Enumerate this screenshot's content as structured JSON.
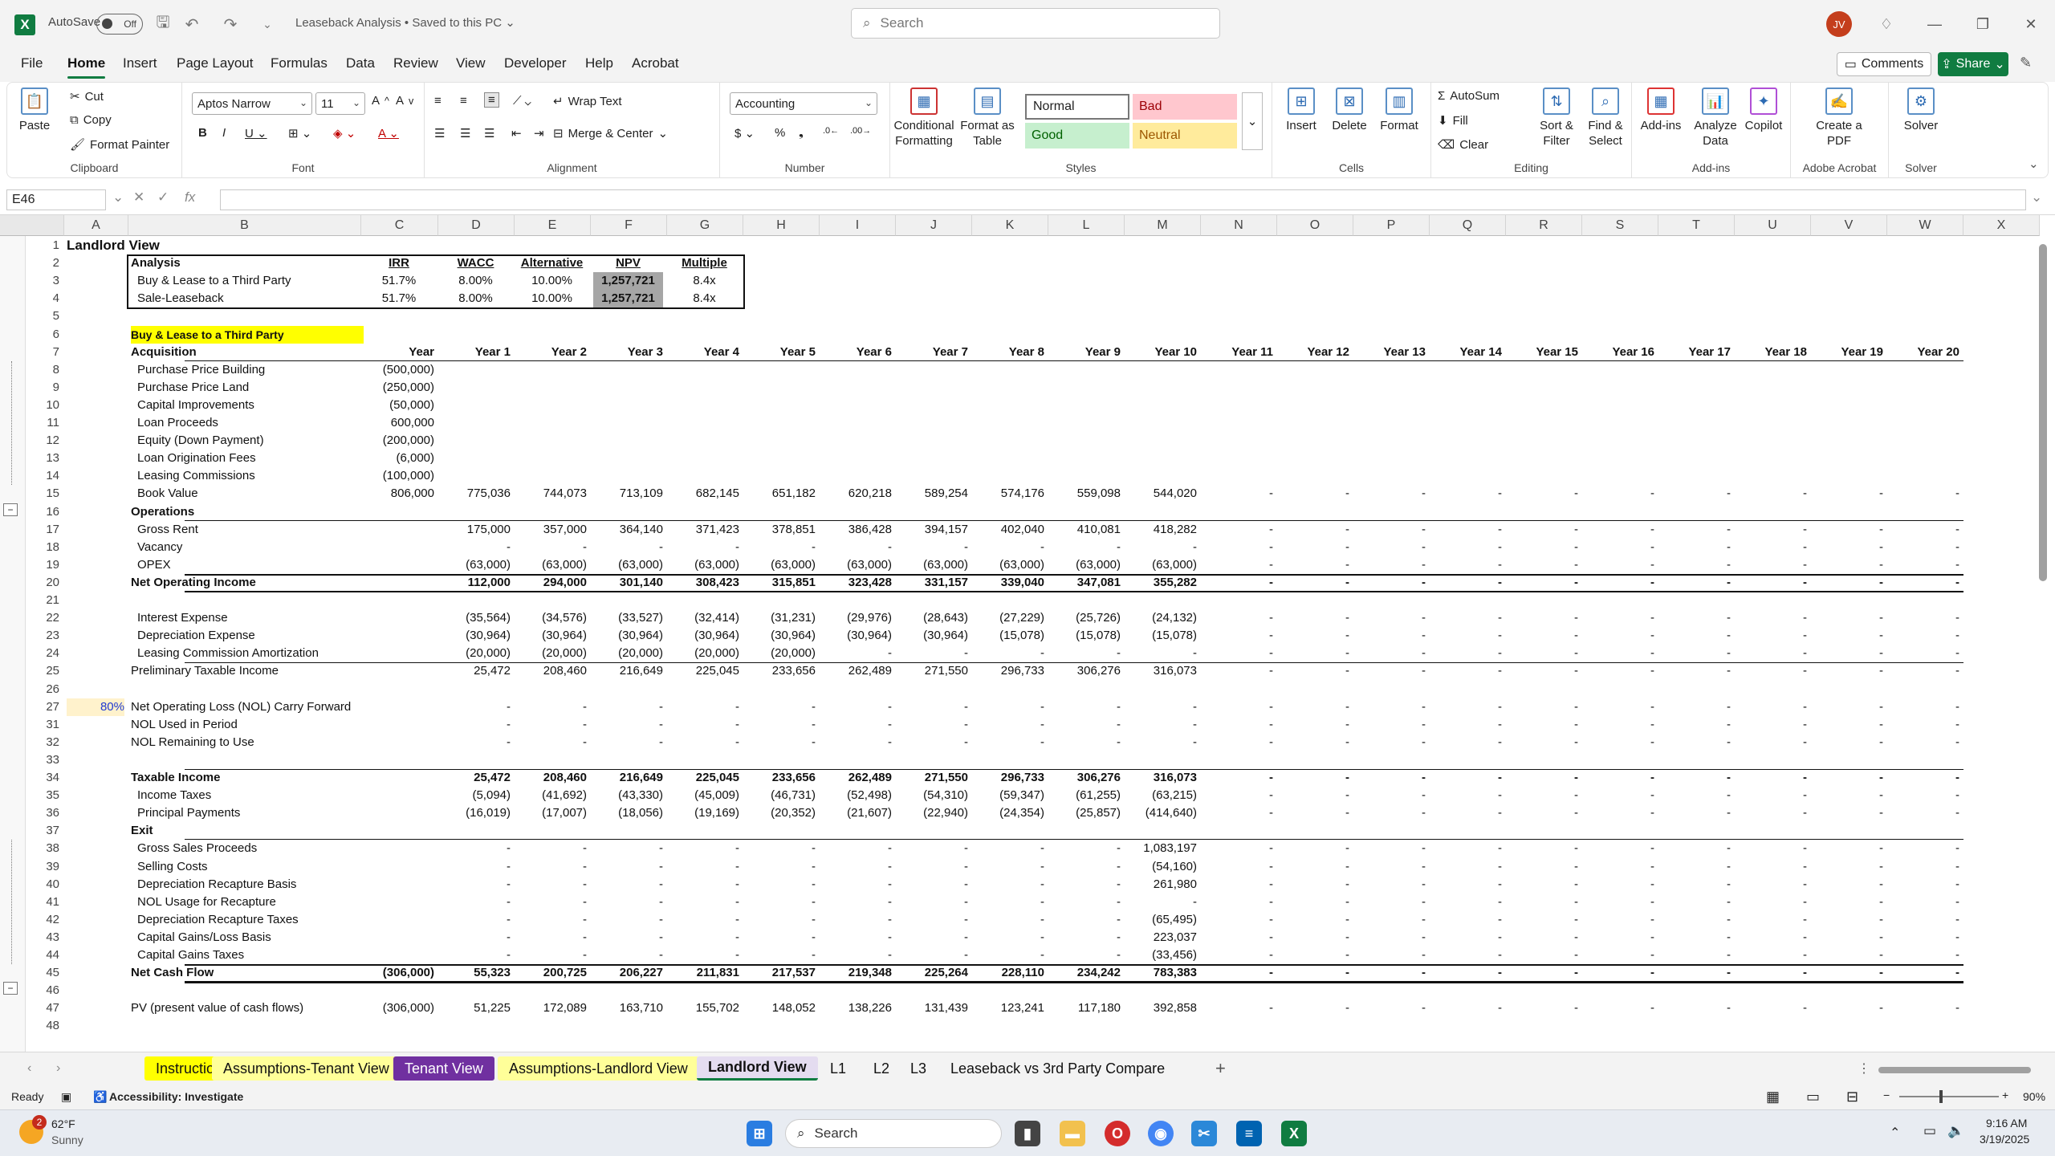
{
  "app": {
    "logo": "X",
    "autosave": "AutoSave",
    "autosave_state": "Off",
    "doc_title": "Leaseback Analysis • Saved to this PC ⌄",
    "search_placeholder": "Search",
    "avatar": "JV",
    "brand_color": "#107c41"
  },
  "menu": [
    "File",
    "Home",
    "Insert",
    "Page Layout",
    "Formulas",
    "Data",
    "Review",
    "View",
    "Developer",
    "Help",
    "Acrobat"
  ],
  "buttons": {
    "comments": "Comments",
    "share": "Share"
  },
  "ribbon": {
    "clipboard": {
      "label": "Clipboard",
      "paste": "Paste",
      "cut": "Cut",
      "copy": "Copy",
      "format_painter": "Format Painter"
    },
    "font": {
      "label": "Font",
      "name": "Aptos Narrow",
      "size": "11"
    },
    "alignment": {
      "label": "Alignment",
      "wrap": "Wrap Text",
      "merge": "Merge & Center"
    },
    "number": {
      "label": "Number",
      "format": "Accounting"
    },
    "styles": {
      "label": "Styles",
      "cond": "Conditional Formatting",
      "table": "Format as Table",
      "normal": "Normal",
      "bad": "Bad",
      "good": "Good",
      "neutral": "Neutral"
    },
    "cells": {
      "label": "Cells",
      "insert": "Insert",
      "delete": "Delete",
      "format": "Format"
    },
    "editing": {
      "label": "Editing",
      "autosum": "AutoSum",
      "fill": "Fill",
      "clear": "Clear",
      "sort": "Sort & Filter",
      "find": "Find & Select"
    },
    "addins": {
      "label": "Add-ins",
      "addins": "Add-ins",
      "analyze": "Analyze Data",
      "copilot": "Copilot"
    },
    "acrobat": {
      "label": "Adobe Acrobat",
      "create": "Create a PDF"
    },
    "solver": {
      "label": "Solver",
      "solver": "Solver"
    }
  },
  "formula": {
    "namebox": "E46",
    "fx": "fx"
  },
  "columns": [
    "A",
    "B",
    "C",
    "D",
    "E",
    "F",
    "G",
    "H",
    "I",
    "J",
    "K",
    "L",
    "M",
    "N",
    "O",
    "P",
    "Q",
    "R",
    "S",
    "T",
    "U",
    "V",
    "W",
    "X"
  ],
  "rows": [
    "1",
    "2",
    "3",
    "4",
    "5",
    "6",
    "7",
    "8",
    "9",
    "10",
    "11",
    "12",
    "13",
    "14",
    "15",
    "16",
    "17",
    "18",
    "19",
    "20",
    "21",
    "22",
    "23",
    "24",
    "25",
    "26",
    "27",
    "31",
    "32",
    "33",
    "34",
    "35",
    "36",
    "37",
    "38",
    "39",
    "40",
    "41",
    "42",
    "43",
    "44",
    "45",
    "46",
    "47",
    "48"
  ],
  "sheet": {
    "title": "Landlord View",
    "summary_headers": [
      "Analysis",
      "IRR",
      "WACC",
      "Alternative",
      "NPV",
      "Multiple"
    ],
    "summary_rows": [
      [
        "Buy & Lease to a Third Party",
        "51.7%",
        "8.00%",
        "10.00%",
        "1,257,721",
        "8.4x"
      ],
      [
        "Sale-Leaseback",
        "51.7%",
        "8.00%",
        "10.00%",
        "1,257,721",
        "8.4x"
      ]
    ],
    "section_title": "Buy & Lease to a Third Party",
    "year_headers": [
      "Year",
      "Year 1",
      "Year 2",
      "Year 3",
      "Year 4",
      "Year 5",
      "Year 6",
      "Year 7",
      "Year 8",
      "Year 9",
      "Year 10",
      "Year 11",
      "Year 12",
      "Year 13",
      "Year 14",
      "Year 15",
      "Year 16",
      "Year 17",
      "Year 18",
      "Year 19",
      "Year 20"
    ],
    "acquisition_label": "Acquisition",
    "nol_rate": "80%",
    "lines": [
      {
        "row": 8,
        "label": "Purchase Price Building",
        "indent": true,
        "vals": [
          "(500,000)"
        ]
      },
      {
        "row": 9,
        "label": "Purchase Price Land",
        "indent": true,
        "vals": [
          "(250,000)"
        ]
      },
      {
        "row": 10,
        "label": "Capital Improvements",
        "indent": true,
        "vals": [
          "(50,000)"
        ]
      },
      {
        "row": 11,
        "label": "Loan Proceeds",
        "indent": true,
        "vals": [
          "600,000"
        ]
      },
      {
        "row": 12,
        "label": "Equity (Down Payment)",
        "indent": true,
        "vals": [
          "(200,000)"
        ]
      },
      {
        "row": 13,
        "label": "Loan Origination Fees",
        "indent": true,
        "vals": [
          "(6,000)"
        ]
      },
      {
        "row": 14,
        "label": "Leasing Commissions",
        "indent": true,
        "vals": [
          "(100,000)"
        ]
      },
      {
        "row": 15,
        "label": "Book Value",
        "indent": true,
        "vals": [
          "806,000",
          "775,036",
          "744,073",
          "713,109",
          "682,145",
          "651,182",
          "620,218",
          "589,254",
          "574,176",
          "559,098",
          "544,020",
          "-",
          "-",
          "-",
          "-",
          "-",
          "-",
          "-",
          "-",
          "-",
          "-"
        ]
      },
      {
        "row": 16,
        "label": "Operations",
        "bold": true,
        "vals": []
      },
      {
        "row": 17,
        "label": "Gross Rent",
        "indent": true,
        "vals": [
          "",
          "175,000",
          "357,000",
          "364,140",
          "371,423",
          "378,851",
          "386,428",
          "394,157",
          "402,040",
          "410,081",
          "418,282",
          "-",
          "-",
          "-",
          "-",
          "-",
          "-",
          "-",
          "-",
          "-",
          "-"
        ]
      },
      {
        "row": 18,
        "label": "Vacancy",
        "indent": true,
        "vals": [
          "",
          "-",
          "-",
          "-",
          "-",
          "-",
          "-",
          "-",
          "-",
          "-",
          "-",
          "-",
          "-",
          "-",
          "-",
          "-",
          "-",
          "-",
          "-",
          "-",
          "-"
        ]
      },
      {
        "row": 19,
        "label": "OPEX",
        "indent": true,
        "vals": [
          "",
          "(63,000)",
          "(63,000)",
          "(63,000)",
          "(63,000)",
          "(63,000)",
          "(63,000)",
          "(63,000)",
          "(63,000)",
          "(63,000)",
          "(63,000)",
          "-",
          "-",
          "-",
          "-",
          "-",
          "-",
          "-",
          "-",
          "-",
          "-"
        ]
      },
      {
        "row": 20,
        "label": "Net Operating Income",
        "bold": true,
        "vals": [
          "",
          "112,000",
          "294,000",
          "301,140",
          "308,423",
          "315,851",
          "323,428",
          "331,157",
          "339,040",
          "347,081",
          "355,282",
          "-",
          "-",
          "-",
          "-",
          "-",
          "-",
          "-",
          "-",
          "-",
          "-"
        ]
      },
      {
        "row": 22,
        "label": "Interest Expense",
        "indent": true,
        "vals": [
          "",
          "(35,564)",
          "(34,576)",
          "(33,527)",
          "(32,414)",
          "(31,231)",
          "(29,976)",
          "(28,643)",
          "(27,229)",
          "(25,726)",
          "(24,132)",
          "-",
          "-",
          "-",
          "-",
          "-",
          "-",
          "-",
          "-",
          "-",
          "-"
        ]
      },
      {
        "row": 23,
        "label": "Depreciation Expense",
        "indent": true,
        "vals": [
          "",
          "(30,964)",
          "(30,964)",
          "(30,964)",
          "(30,964)",
          "(30,964)",
          "(30,964)",
          "(30,964)",
          "(15,078)",
          "(15,078)",
          "(15,078)",
          "-",
          "-",
          "-",
          "-",
          "-",
          "-",
          "-",
          "-",
          "-",
          "-"
        ]
      },
      {
        "row": 24,
        "label": "Leasing Commission Amortization",
        "indent": true,
        "vals": [
          "",
          "(20,000)",
          "(20,000)",
          "(20,000)",
          "(20,000)",
          "(20,000)",
          "-",
          "-",
          "-",
          "-",
          "-",
          "-",
          "-",
          "-",
          "-",
          "-",
          "-",
          "-",
          "-",
          "-",
          "-"
        ]
      },
      {
        "row": 25,
        "label": "Preliminary Taxable Income",
        "vals": [
          "",
          "25,472",
          "208,460",
          "216,649",
          "225,045",
          "233,656",
          "262,489",
          "271,550",
          "296,733",
          "306,276",
          "316,073",
          "-",
          "-",
          "-",
          "-",
          "-",
          "-",
          "-",
          "-",
          "-",
          "-"
        ]
      },
      {
        "row": 27,
        "label": "Net Operating Loss (NOL) Carry Forward",
        "vals": [
          "",
          "-",
          "-",
          "-",
          "-",
          "-",
          "-",
          "-",
          "-",
          "-",
          "-",
          "-",
          "-",
          "-",
          "-",
          "-",
          "-",
          "-",
          "-",
          "-",
          "-"
        ]
      },
      {
        "row": 31,
        "label": "NOL Used in Period",
        "vals": [
          "",
          "-",
          "-",
          "-",
          "-",
          "-",
          "-",
          "-",
          "-",
          "-",
          "-",
          "-",
          "-",
          "-",
          "-",
          "-",
          "-",
          "-",
          "-",
          "-",
          "-"
        ]
      },
      {
        "row": 32,
        "label": "NOL Remaining to Use",
        "vals": [
          "",
          "-",
          "-",
          "-",
          "-",
          "-",
          "-",
          "-",
          "-",
          "-",
          "-",
          "-",
          "-",
          "-",
          "-",
          "-",
          "-",
          "-",
          "-",
          "-",
          "-"
        ]
      },
      {
        "row": 34,
        "label": "Taxable Income",
        "bold": true,
        "vals": [
          "",
          "25,472",
          "208,460",
          "216,649",
          "225,045",
          "233,656",
          "262,489",
          "271,550",
          "296,733",
          "306,276",
          "316,073",
          "-",
          "-",
          "-",
          "-",
          "-",
          "-",
          "-",
          "-",
          "-",
          "-"
        ]
      },
      {
        "row": 35,
        "label": "Income Taxes",
        "indent": true,
        "vals": [
          "",
          "(5,094)",
          "(41,692)",
          "(43,330)",
          "(45,009)",
          "(46,731)",
          "(52,498)",
          "(54,310)",
          "(59,347)",
          "(61,255)",
          "(63,215)",
          "-",
          "-",
          "-",
          "-",
          "-",
          "-",
          "-",
          "-",
          "-",
          "-"
        ]
      },
      {
        "row": 36,
        "label": "Principal Payments",
        "indent": true,
        "vals": [
          "",
          "(16,019)",
          "(17,007)",
          "(18,056)",
          "(19,169)",
          "(20,352)",
          "(21,607)",
          "(22,940)",
          "(24,354)",
          "(25,857)",
          "(414,640)",
          "-",
          "-",
          "-",
          "-",
          "-",
          "-",
          "-",
          "-",
          "-",
          "-"
        ]
      },
      {
        "row": 37,
        "label": "Exit",
        "bold": true,
        "vals": []
      },
      {
        "row": 38,
        "label": "Gross Sales Proceeds",
        "indent": true,
        "vals": [
          "",
          "-",
          "-",
          "-",
          "-",
          "-",
          "-",
          "-",
          "-",
          "-",
          "1,083,197",
          "-",
          "-",
          "-",
          "-",
          "-",
          "-",
          "-",
          "-",
          "-",
          "-"
        ]
      },
      {
        "row": 39,
        "label": "Selling Costs",
        "indent": true,
        "vals": [
          "",
          "-",
          "-",
          "-",
          "-",
          "-",
          "-",
          "-",
          "-",
          "-",
          "(54,160)",
          "-",
          "-",
          "-",
          "-",
          "-",
          "-",
          "-",
          "-",
          "-",
          "-"
        ]
      },
      {
        "row": 40,
        "label": "Depreciation Recapture Basis",
        "indent": true,
        "vals": [
          "",
          "-",
          "-",
          "-",
          "-",
          "-",
          "-",
          "-",
          "-",
          "-",
          "261,980",
          "-",
          "-",
          "-",
          "-",
          "-",
          "-",
          "-",
          "-",
          "-",
          "-"
        ]
      },
      {
        "row": 41,
        "label": "NOL Usage for Recapture",
        "indent": true,
        "vals": [
          "",
          "-",
          "-",
          "-",
          "-",
          "-",
          "-",
          "-",
          "-",
          "-",
          "-",
          "-",
          "-",
          "-",
          "-",
          "-",
          "-",
          "-",
          "-",
          "-",
          "-"
        ]
      },
      {
        "row": 42,
        "label": "Depreciation Recapture Taxes",
        "indent": true,
        "vals": [
          "",
          "-",
          "-",
          "-",
          "-",
          "-",
          "-",
          "-",
          "-",
          "-",
          "(65,495)",
          "-",
          "-",
          "-",
          "-",
          "-",
          "-",
          "-",
          "-",
          "-",
          "-"
        ]
      },
      {
        "row": 43,
        "label": "Capital Gains/Loss Basis",
        "indent": true,
        "vals": [
          "",
          "-",
          "-",
          "-",
          "-",
          "-",
          "-",
          "-",
          "-",
          "-",
          "223,037",
          "-",
          "-",
          "-",
          "-",
          "-",
          "-",
          "-",
          "-",
          "-",
          "-"
        ]
      },
      {
        "row": 44,
        "label": "Capital Gains Taxes",
        "indent": true,
        "vals": [
          "",
          "-",
          "-",
          "-",
          "-",
          "-",
          "-",
          "-",
          "-",
          "-",
          "(33,456)",
          "-",
          "-",
          "-",
          "-",
          "-",
          "-",
          "-",
          "-",
          "-",
          "-"
        ]
      },
      {
        "row": 45,
        "label": "Net Cash Flow",
        "bold": true,
        "vals": [
          "(306,000)",
          "55,323",
          "200,725",
          "206,227",
          "211,831",
          "217,537",
          "219,348",
          "225,264",
          "228,110",
          "234,242",
          "783,383",
          "-",
          "-",
          "-",
          "-",
          "-",
          "-",
          "-",
          "-",
          "-",
          "-"
        ]
      },
      {
        "row": 47,
        "label": "PV (present value of cash flows)",
        "vals": [
          "(306,000)",
          "51,225",
          "172,089",
          "163,710",
          "155,702",
          "148,052",
          "138,226",
          "131,439",
          "123,241",
          "117,180",
          "392,858",
          "-",
          "-",
          "-",
          "-",
          "-",
          "-",
          "-",
          "-",
          "-",
          "-"
        ]
      }
    ]
  },
  "tabs": [
    {
      "label": "Instructions",
      "bg": "#ffff00",
      "fg": "#111"
    },
    {
      "label": "Assumptions-Tenant View",
      "bg": "#ffff99",
      "fg": "#111"
    },
    {
      "label": "Tenant View",
      "bg": "#7030a0",
      "fg": "#ffffff"
    },
    {
      "label": "Assumptions-Landlord View",
      "bg": "#ffff99",
      "fg": "#111"
    },
    {
      "label": "Landlord View",
      "bg": "#e4dcf0",
      "fg": "#111",
      "active": true
    },
    {
      "label": "L1",
      "bg": "",
      "fg": "#111"
    },
    {
      "label": "L2",
      "bg": "",
      "fg": "#111"
    },
    {
      "label": "L3",
      "bg": "",
      "fg": "#111"
    },
    {
      "label": "Leaseback vs 3rd Party Compare",
      "bg": "",
      "fg": "#111"
    }
  ],
  "status": {
    "ready": "Ready",
    "accessibility": "Accessibility: Investigate",
    "zoom": "90%"
  },
  "taskbar": {
    "temp": "62°F",
    "weather": "Sunny",
    "search": "Search",
    "time": "9:16 AM",
    "date": "3/19/2025",
    "badge": "2"
  }
}
